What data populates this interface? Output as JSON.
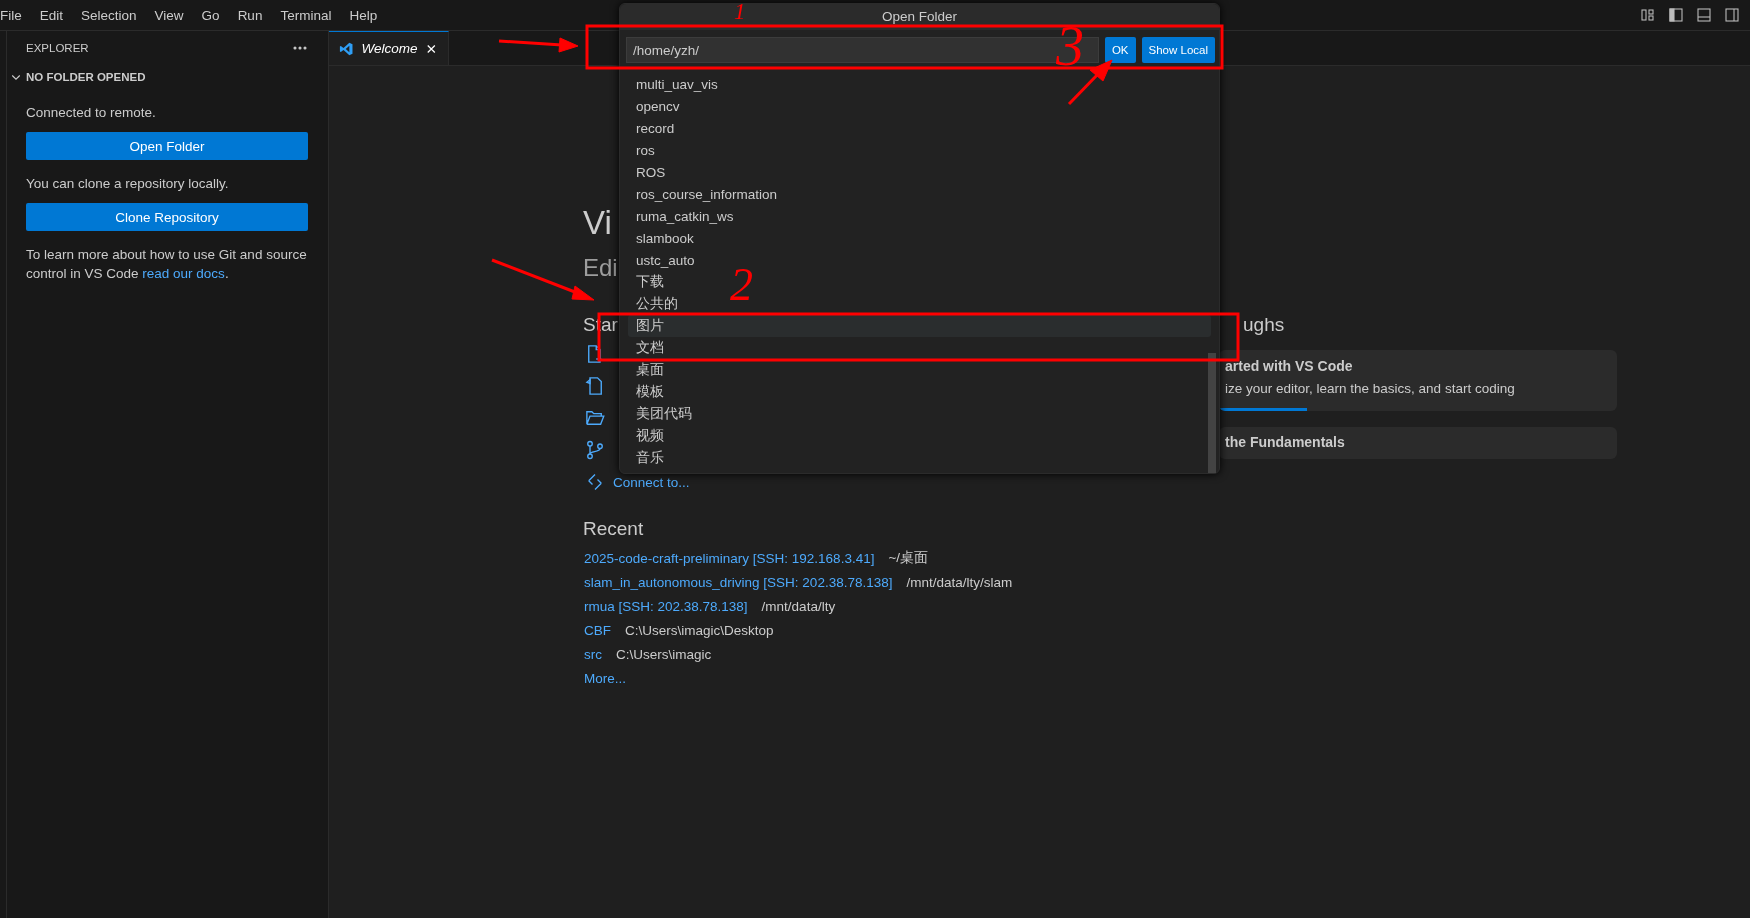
{
  "menu": [
    "File",
    "Edit",
    "Selection",
    "View",
    "Go",
    "Run",
    "Terminal",
    "Help"
  ],
  "sidebar": {
    "title": "EXPLORER",
    "section": {
      "label": "NO FOLDER OPENED",
      "expanded": true
    },
    "connected_text": "Connected to remote.",
    "open_folder_button": "Open Folder",
    "clone_text": "You can clone a repository locally.",
    "clone_button": "Clone Repository",
    "learn_text": "To learn more about how to use Git and source control in VS Code ",
    "learn_link": "read our docs",
    "learn_end": "."
  },
  "tabs": [
    {
      "label": "Welcome",
      "selected": true
    }
  ],
  "welcome": {
    "title": "Vi",
    "subtitle": "Edi",
    "start": {
      "heading": "Star",
      "items": [
        {
          "kind": "new-file"
        },
        {
          "kind": "open-file"
        },
        {
          "kind": "open-folder"
        },
        {
          "kind": "clone"
        },
        {
          "kind": "connect",
          "label": "Connect to..."
        }
      ]
    },
    "recent": {
      "heading": "Recent",
      "items": [
        {
          "name": "2025-code-craft-preliminary [SSH: 192.168.3.41]",
          "path": "~/桌面"
        },
        {
          "name": "slam_in_autonomous_driving [SSH: 202.38.78.138]",
          "path": "/mnt/data/lty/slam"
        },
        {
          "name": "rmua [SSH: 202.38.78.138]",
          "path": "/mnt/data/lty"
        },
        {
          "name": "CBF",
          "path": "C:\\Users\\imagic\\Desktop"
        },
        {
          "name": "src",
          "path": "C:\\Users\\imagic"
        }
      ],
      "more": "More..."
    },
    "walkthroughs": {
      "heading": "ughs",
      "cards": [
        {
          "title": "arted with VS Code",
          "description": "ize your editor, learn the basics, and start coding",
          "level": 0.22
        },
        {
          "title": "the Fundamentals"
        }
      ]
    }
  },
  "dialog": {
    "title": "Open Folder",
    "value": "/home/yzh/",
    "buttons": [
      "OK",
      "Show Local"
    ],
    "items": [
      {
        "label": "multi_uav_vis",
        "selected": false
      },
      {
        "label": "opencv",
        "selected": false
      },
      {
        "label": "record",
        "selected": false
      },
      {
        "label": "ros",
        "selected": false
      },
      {
        "label": "ROS",
        "selected": false
      },
      {
        "label": "ros_course_information",
        "selected": false
      },
      {
        "label": "ruma_catkin_ws",
        "selected": false
      },
      {
        "label": "slambook",
        "selected": false
      },
      {
        "label": "ustc_auto",
        "selected": false
      },
      {
        "label": "下载",
        "selected": false
      },
      {
        "label": "公共的",
        "selected": false
      },
      {
        "label": "图片",
        "selected": true
      },
      {
        "label": "文档",
        "selected": false
      },
      {
        "label": "桌面",
        "selected": false
      },
      {
        "label": "模板",
        "selected": false
      },
      {
        "label": "美团代码",
        "selected": false
      },
      {
        "label": "视频",
        "selected": false
      },
      {
        "label": "音乐",
        "selected": false
      }
    ]
  },
  "annotations": {
    "labels": [
      "1",
      "2",
      "3"
    ]
  }
}
